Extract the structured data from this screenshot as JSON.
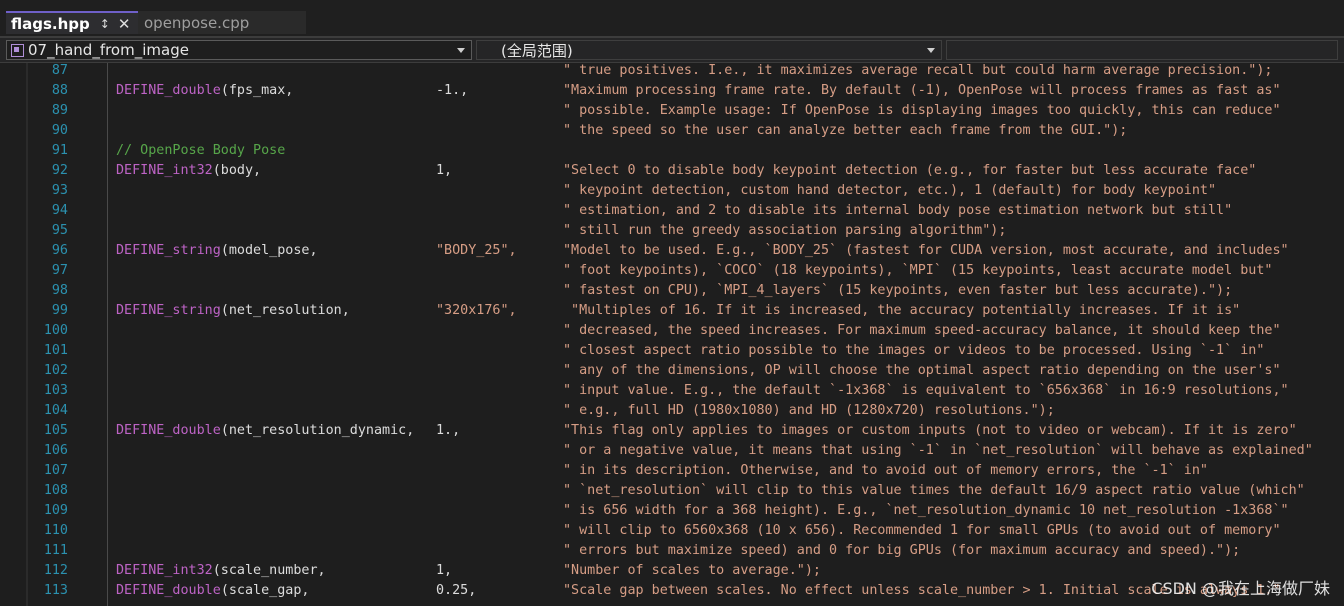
{
  "tabs": {
    "active": {
      "label": "flags.hpp",
      "pin": "↕",
      "close": "✕"
    },
    "other": {
      "label": "openpose.cpp"
    }
  },
  "navbar": {
    "scope": "07_hand_from_image",
    "member": "(全局范围)"
  },
  "code": {
    "lines": [
      {
        "n": "87",
        "desc": "\" true positives. I.e., it maximizes average recall but could harm average precision.\");"
      },
      {
        "n": "88",
        "macro": "DEFINE_double",
        "args": "(fps_max,",
        "arg2": "-1.,",
        "desc": "\"Maximum processing frame rate. By default (-1), OpenPose will process frames as fast as\""
      },
      {
        "n": "89",
        "desc": "\" possible. Example usage: If OpenPose is displaying images too quickly, this can reduce\""
      },
      {
        "n": "90",
        "desc": "\" the speed so the user can analyze better each frame from the GUI.\");"
      },
      {
        "n": "91",
        "comment": "// OpenPose Body Pose"
      },
      {
        "n": "92",
        "macro": "DEFINE_int32",
        "args": "(body,",
        "arg2": "1,",
        "desc": "\"Select 0 to disable body keypoint detection (e.g., for faster but less accurate face\""
      },
      {
        "n": "93",
        "desc": "\" keypoint detection, custom hand detector, etc.), 1 (default) for body keypoint\""
      },
      {
        "n": "94",
        "desc": "\" estimation, and 2 to disable its internal body pose estimation network but still\""
      },
      {
        "n": "95",
        "desc": "\" still run the greedy association parsing algorithm\");"
      },
      {
        "n": "96",
        "macro": "DEFINE_string",
        "args": "(model_pose,",
        "arg2": "\"BODY_25\",",
        "desc": "\"Model to be used. E.g., `BODY_25` (fastest for CUDA version, most accurate, and includes\""
      },
      {
        "n": "97",
        "desc": "\" foot keypoints), `COCO` (18 keypoints), `MPI` (15 keypoints, least accurate model but\""
      },
      {
        "n": "98",
        "desc": "\" fastest on CPU), `MPI_4_layers` (15 keypoints, even faster but less accurate).\");"
      },
      {
        "n": "99",
        "macro": "DEFINE_string",
        "args": "(net_resolution,",
        "arg2": "\"320x176\",",
        "desc": " \"Multiples of 16. If it is increased, the accuracy potentially increases. If it is\""
      },
      {
        "n": "100",
        "desc": "\" decreased, the speed increases. For maximum speed-accuracy balance, it should keep the\""
      },
      {
        "n": "101",
        "desc": "\" closest aspect ratio possible to the images or videos to be processed. Using `-1` in\""
      },
      {
        "n": "102",
        "desc": "\" any of the dimensions, OP will choose the optimal aspect ratio depending on the user's\""
      },
      {
        "n": "103",
        "desc": "\" input value. E.g., the default `-1x368` is equivalent to `656x368` in 16:9 resolutions,\""
      },
      {
        "n": "104",
        "desc": "\" e.g., full HD (1980x1080) and HD (1280x720) resolutions.\");"
      },
      {
        "n": "105",
        "macro": "DEFINE_double",
        "args": "(net_resolution_dynamic,",
        "arg2": "1.,",
        "desc": "\"This flag only applies to images or custom inputs (not to video or webcam). If it is zero\""
      },
      {
        "n": "106",
        "desc": "\" or a negative value, it means that using `-1` in `net_resolution` will behave as explained\""
      },
      {
        "n": "107",
        "desc": "\" in its description. Otherwise, and to avoid out of memory errors, the `-1` in\""
      },
      {
        "n": "108",
        "desc": "\" `net_resolution` will clip to this value times the default 16/9 aspect ratio value (which\""
      },
      {
        "n": "109",
        "desc": "\" is 656 width for a 368 height). E.g., `net_resolution_dynamic 10 net_resolution -1x368`\""
      },
      {
        "n": "110",
        "desc": "\" will clip to 6560x368 (10 x 656). Recommended 1 for small GPUs (to avoid out of memory\""
      },
      {
        "n": "111",
        "desc": "\" errors but maximize speed) and 0 for big GPUs (for maximum accuracy and speed).\");"
      },
      {
        "n": "112",
        "macro": "DEFINE_int32",
        "args": "(scale_number,",
        "arg2": "1,",
        "desc": "\"Number of scales to average.\");"
      },
      {
        "n": "113",
        "macro": "DEFINE_double",
        "args": "(scale_gap,",
        "arg2": "0.25,",
        "desc": "\"Scale gap between scales. No effect unless scale_number > 1. Initial scale is always 1.\""
      }
    ]
  },
  "watermark": "CSDN @我在上海做厂妹"
}
